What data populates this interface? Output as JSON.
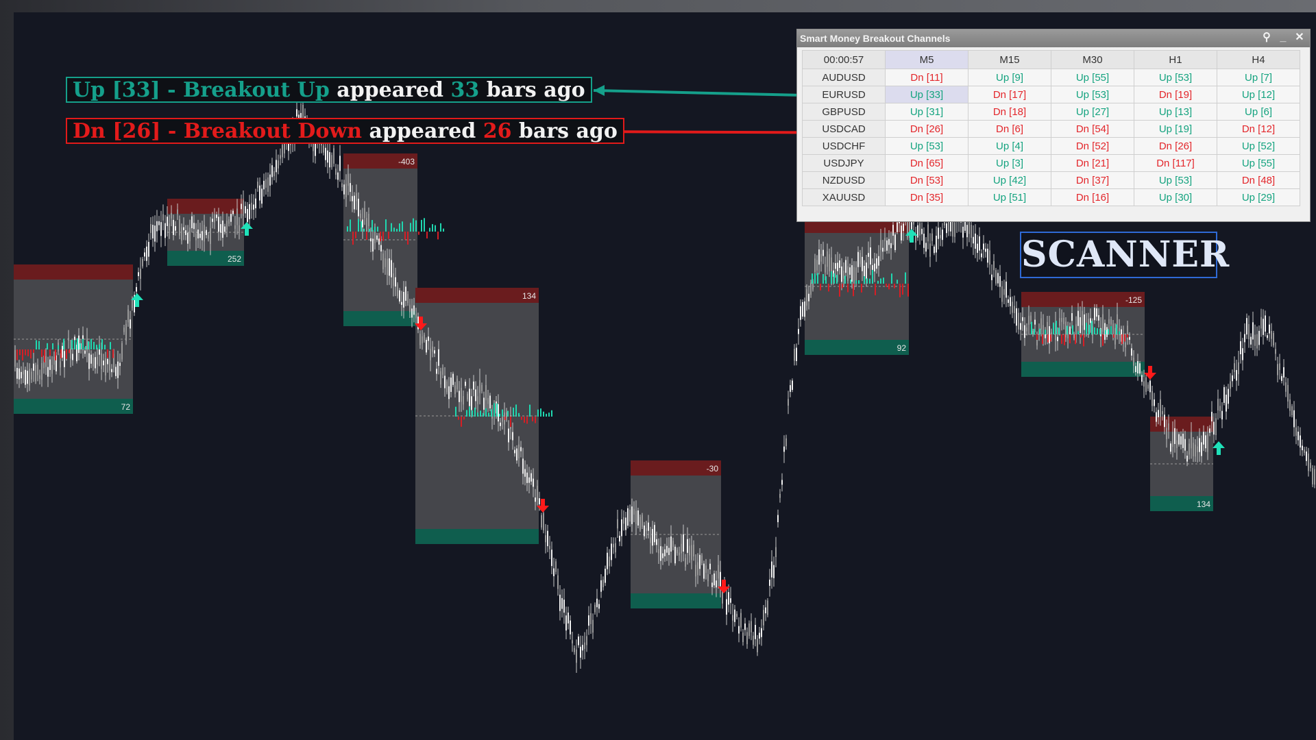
{
  "callouts": {
    "up": {
      "prefix": "Up [33] - Breakout Up",
      "appeared": "appeared",
      "count": "33",
      "suffix": "bars ago"
    },
    "dn": {
      "prefix": "Dn [26] - Breakout Down",
      "appeared": "appeared",
      "count": "26",
      "suffix": "bars ago"
    }
  },
  "scanner_label": "SCANNER",
  "panel": {
    "title": "Smart Money Breakout Channels",
    "timer": "00:00:57",
    "timeframes": [
      "M5",
      "M15",
      "M30",
      "H1",
      "H4"
    ],
    "active_timeframe": "M5",
    "rows": [
      {
        "symbol": "AUDUSD",
        "cells": [
          "Dn [11]",
          "Up [9]",
          "Up [55]",
          "Up [53]",
          "Up [7]"
        ]
      },
      {
        "symbol": "EURUSD",
        "cells": [
          "Up [33]",
          "Dn [17]",
          "Up [53]",
          "Dn [19]",
          "Up [12]"
        ]
      },
      {
        "symbol": "GBPUSD",
        "cells": [
          "Up [31]",
          "Dn [18]",
          "Up [27]",
          "Up [13]",
          "Up [6]"
        ]
      },
      {
        "symbol": "USDCAD",
        "cells": [
          "Dn [26]",
          "Dn [6]",
          "Dn [54]",
          "Up [19]",
          "Dn [12]"
        ]
      },
      {
        "symbol": "USDCHF",
        "cells": [
          "Up [53]",
          "Up [4]",
          "Dn [52]",
          "Dn [26]",
          "Up [52]"
        ]
      },
      {
        "symbol": "USDJPY",
        "cells": [
          "Dn [65]",
          "Up [3]",
          "Dn [21]",
          "Dn [117]",
          "Up [55]"
        ]
      },
      {
        "symbol": "NZDUSD",
        "cells": [
          "Dn [53]",
          "Up [42]",
          "Dn [37]",
          "Up [53]",
          "Dn [48]"
        ]
      },
      {
        "symbol": "XAUUSD",
        "cells": [
          "Dn [35]",
          "Up [51]",
          "Dn [16]",
          "Up [30]",
          "Up [29]"
        ]
      }
    ],
    "highlighted": {
      "row": "EURUSD",
      "column": "M5"
    }
  },
  "channels": [
    {
      "label": "72"
    },
    {
      "label": "252"
    },
    {
      "label": "-403"
    },
    {
      "label": "134"
    },
    {
      "label": "-30"
    },
    {
      "label": "92"
    },
    {
      "label": "-125"
    },
    {
      "label": "134"
    }
  ],
  "colors": {
    "background": "#141722",
    "bullish": "#15a08b",
    "bearish": "#e21a1a",
    "candle": "#c8c8c8",
    "channel_fill": "#4a4b50",
    "signal_up_arrow": "#1fe0b8",
    "signal_down_arrow": "#ff1a1a"
  }
}
